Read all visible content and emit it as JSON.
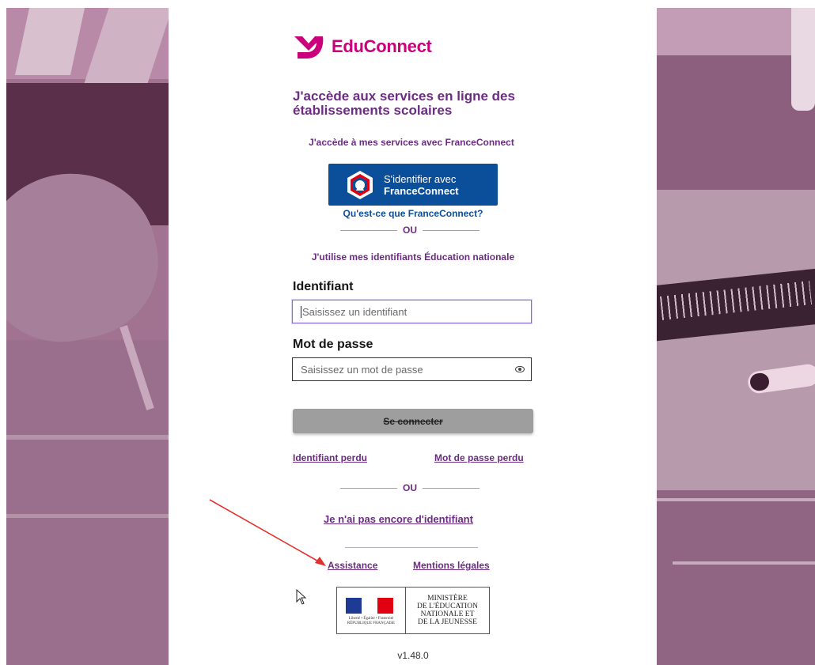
{
  "logo": {
    "name": "EduConnect",
    "brand_color": "#cb007b"
  },
  "heading": "J'accède aux services en ligne des établissements scolaires",
  "franceconnect": {
    "intro": "J'accède à mes services avec FranceConnect",
    "button_line1": "S'identifier avec",
    "button_line2": "FranceConnect",
    "what_link": "Qu'est-ce que FranceConnect?",
    "button_color": "#0b4f9a"
  },
  "separator_text": "OU",
  "education_nationale": {
    "intro": "J'utilise mes identifiants Éducation nationale"
  },
  "form": {
    "username_label": "Identifiant",
    "username_placeholder": "Saisissez un identifiant",
    "password_label": "Mot de passe",
    "password_placeholder": "Saisissez un mot de passe",
    "password_toggle_icon": "eye-icon",
    "submit_label": "Se connecter"
  },
  "links": {
    "lost_username": "Identifiant perdu",
    "lost_password": "Mot de passe perdu",
    "no_account": "Je n'ai pas encore d'identifiant",
    "assistance": "Assistance",
    "legal": "Mentions légales"
  },
  "ministry": {
    "line1": "MINISTÈRE",
    "line2": "DE L'ÉDUCATION",
    "line3": "NATIONALE ET",
    "line4": "DE LA JEUNESSE",
    "motto": "Liberté • Égalité • Fraternité",
    "republic": "RÉPUBLIQUE FRANÇAISE"
  },
  "version": "v1.48.0",
  "annotation": {
    "type": "arrow",
    "color": "#e0312c"
  },
  "accent_color": "#6b2c82"
}
